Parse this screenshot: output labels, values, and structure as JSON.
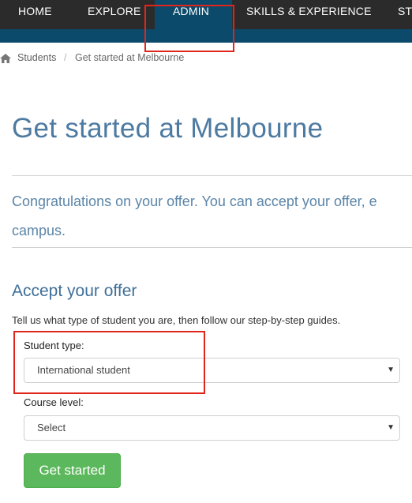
{
  "nav": {
    "items": [
      {
        "label": "HOME"
      },
      {
        "label": "EXPLORE"
      },
      {
        "label": "ADMIN",
        "active": true
      },
      {
        "label": "SKILLS & EXPERIENCE"
      },
      {
        "label": "ST"
      }
    ],
    "active_color": "#0b4a6a",
    "bar_color": "#2b2b2b"
  },
  "breadcrumb": {
    "home_icon": "home-icon",
    "items": [
      "Students",
      "Get started at Melbourne"
    ],
    "separator": "/"
  },
  "page": {
    "title": "Get started at Melbourne",
    "intro_line1": "Congratulations on your offer. You can accept your offer, e",
    "intro_line2": "campus."
  },
  "accept": {
    "title": "Accept your offer",
    "helper": "Tell us what type of student you are, then follow our step-by-step guides.",
    "student_type_label": "Student type:",
    "student_type_value": "International student",
    "course_level_label": "Course level:",
    "course_level_value": "Select",
    "button_label": "Get started",
    "button_color": "#5cb85c"
  },
  "highlight_color": "#e0261b"
}
